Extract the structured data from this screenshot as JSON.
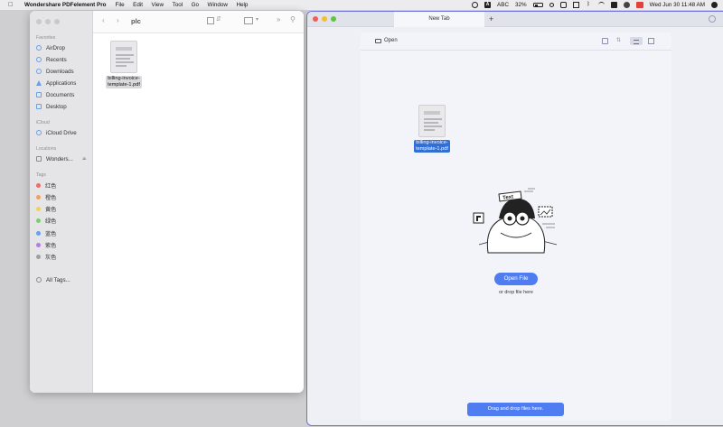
{
  "menubar": {
    "app_name": "Wondershare PDFelement Pro",
    "menus": [
      "File",
      "Edit",
      "View",
      "Tool",
      "Go",
      "Window",
      "Help"
    ],
    "input_source": "ABC",
    "battery": "32%",
    "datetime": "Wed Jun 30  11:48 AM"
  },
  "finder": {
    "folder_title": "plc",
    "sidebar": {
      "favorites_header": "Favorites",
      "favorites": [
        "AirDrop",
        "Recents",
        "Downloads",
        "Applications",
        "Documents",
        "Desktop"
      ],
      "icloud_header": "iCloud",
      "icloud_items": [
        "iCloud Drive"
      ],
      "locations_header": "Locations",
      "locations": [
        "Wonders..."
      ],
      "tags_header": "Tags",
      "tags": [
        {
          "label": "红色",
          "color": "#f16a6a"
        },
        {
          "label": "橙色",
          "color": "#f5a05a"
        },
        {
          "label": "黄色",
          "color": "#f3d05a"
        },
        {
          "label": "绿色",
          "color": "#76cf6a"
        },
        {
          "label": "蓝色",
          "color": "#6a9ff0"
        },
        {
          "label": "紫色",
          "color": "#b77ce0"
        },
        {
          "label": "灰色",
          "color": "#a0a0a4"
        }
      ],
      "all_tags": "All Tags..."
    },
    "file": {
      "line1": "billing-invoice-",
      "line2": "template-1.pdf"
    }
  },
  "pdfelement": {
    "tab_label": "New Tab",
    "open_label": "Open",
    "file": {
      "line1": "billing-invoice-",
      "line2": "template-1.pdf"
    },
    "illustration_text": "Text",
    "open_file_button": "Open File",
    "drop_hint": "or drop file here",
    "drag_bar": "Drag and drop files here.",
    "accent_color": "#4f7cf0",
    "window_border_color": "#6b72e0"
  }
}
